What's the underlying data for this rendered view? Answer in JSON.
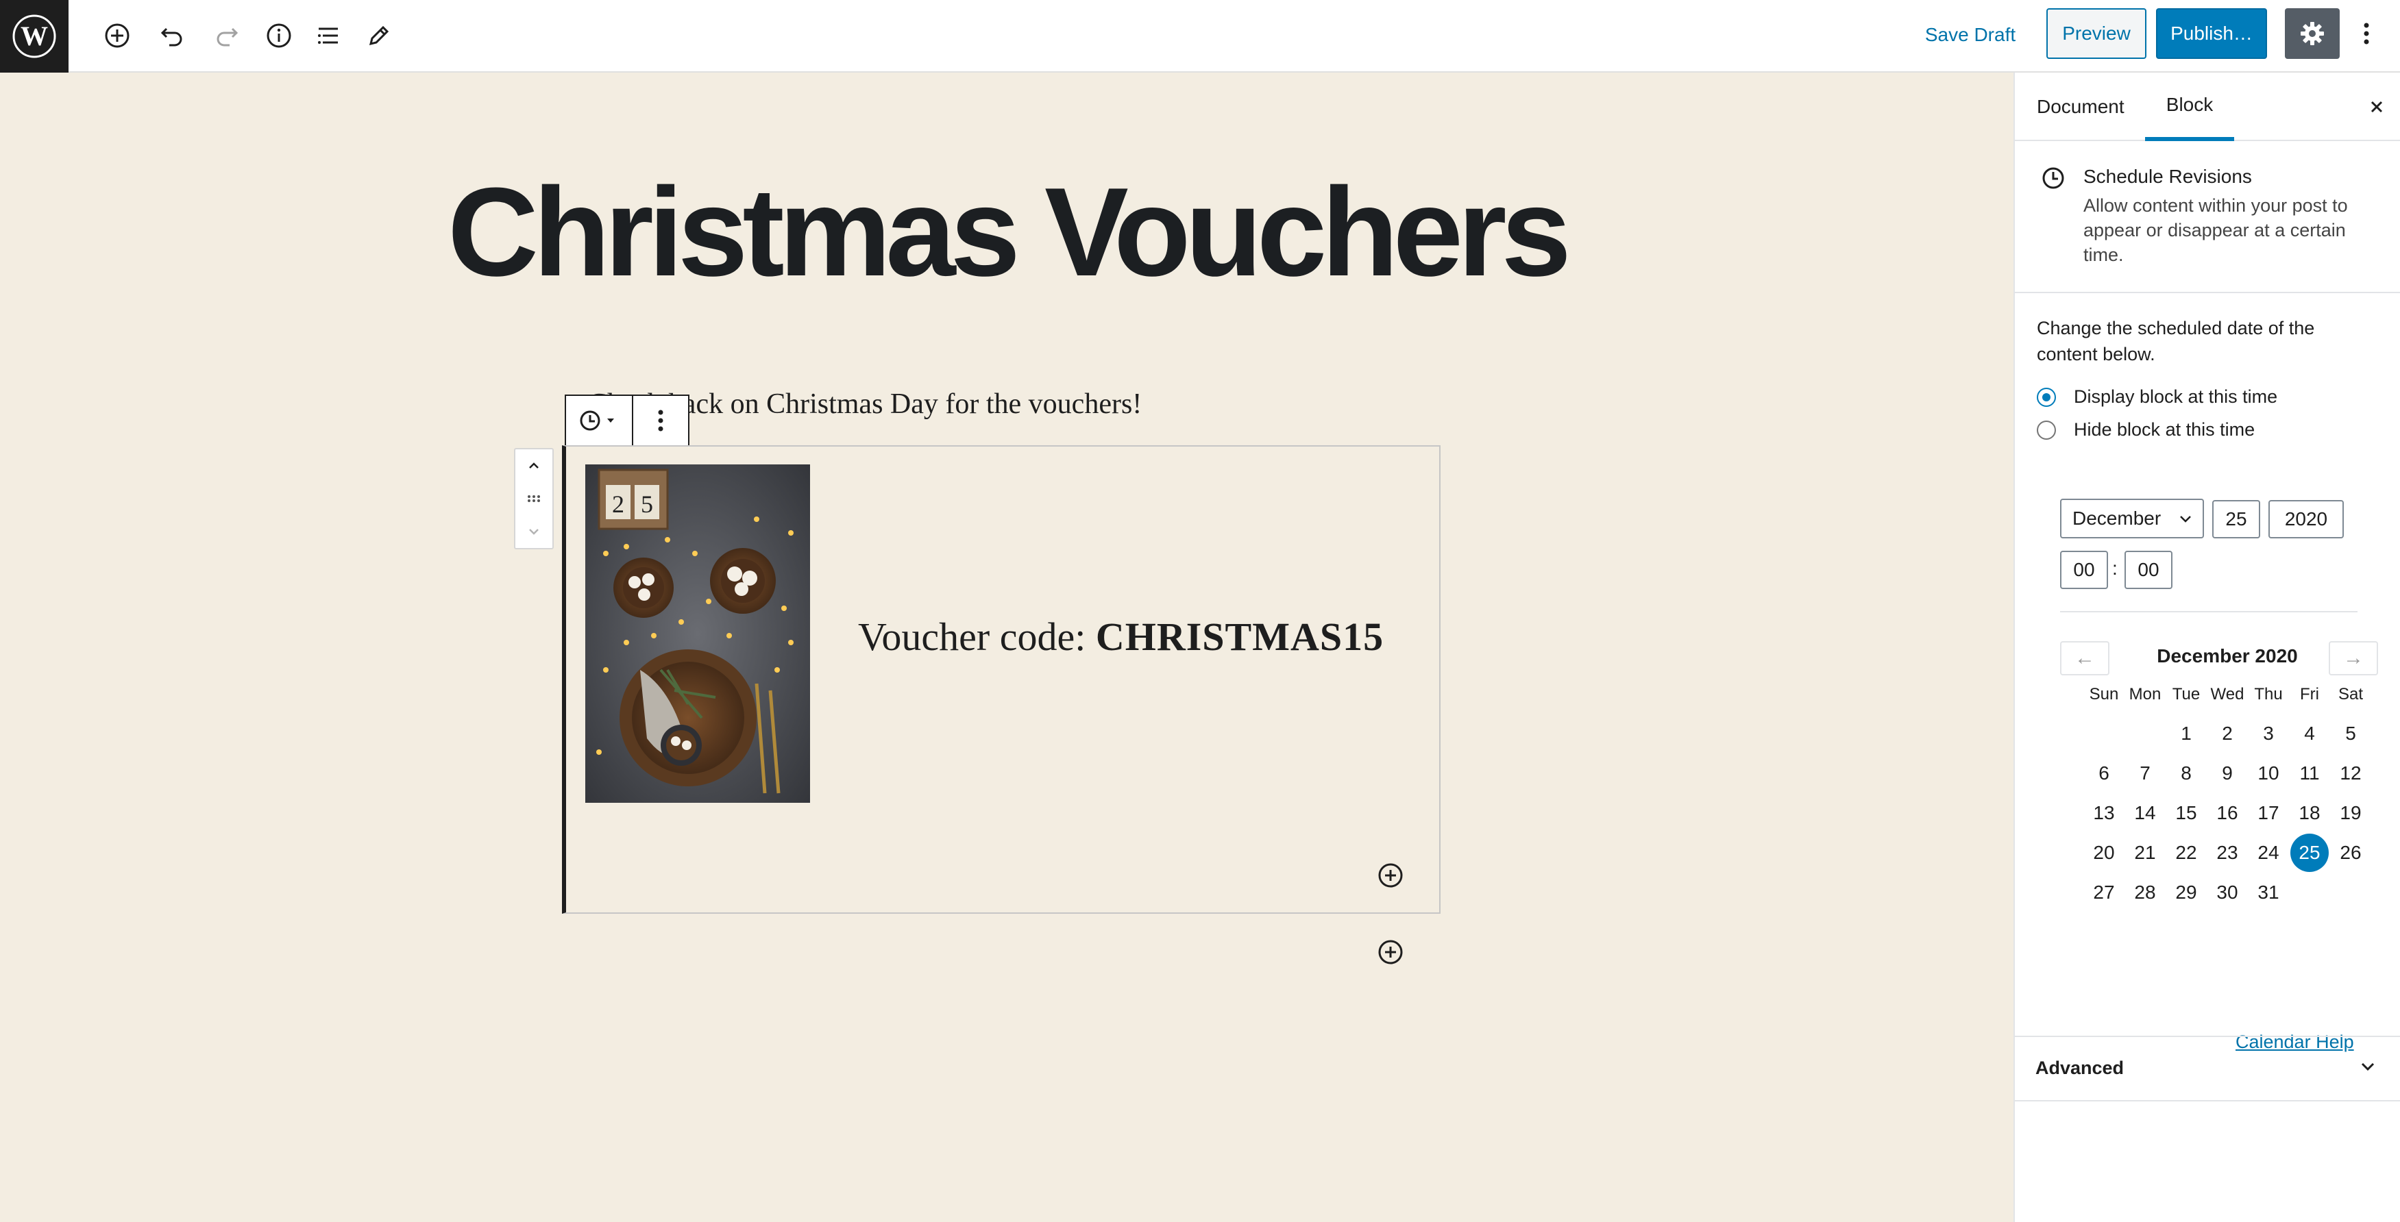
{
  "toolbar": {
    "save_draft": "Save Draft",
    "preview": "Preview",
    "publish": "Publish…",
    "icons": [
      "wordpress-logo",
      "add-block-icon",
      "undo-icon",
      "redo-icon",
      "info-icon",
      "outline-icon",
      "edit-mode-icon",
      "settings-gear-icon",
      "more-options-icon"
    ]
  },
  "editor": {
    "title": "Christmas Vouchers",
    "paragraph": "Check back on Christmas Day for the vouchers!",
    "voucher_prefix": "Voucher code:",
    "voucher_code": "CHRISTMAS15"
  },
  "sidebar": {
    "tabs": {
      "document": "Document",
      "block": "Block"
    },
    "schedule": {
      "title": "Schedule Revisions",
      "description": "Allow content within your post to appear or disappear at a certain time."
    },
    "change_text": "Change the scheduled date of the content below.",
    "radios": {
      "display": "Display block at this time",
      "hide": "Hide block at this time",
      "selected": "display"
    },
    "date": {
      "month": "December",
      "day": "25",
      "year": "2020",
      "hour": "00",
      "minute": "00",
      "separator": ":"
    },
    "calendar": {
      "title": "December 2020",
      "prev": "←",
      "next": "→",
      "weekdays": [
        "Sun",
        "Mon",
        "Tue",
        "Wed",
        "Thu",
        "Fri",
        "Sat"
      ],
      "weeks": [
        [
          "",
          "",
          "1",
          "2",
          "3",
          "4",
          "5"
        ],
        [
          "6",
          "7",
          "8",
          "9",
          "10",
          "11",
          "12"
        ],
        [
          "13",
          "14",
          "15",
          "16",
          "17",
          "18",
          "19"
        ],
        [
          "20",
          "21",
          "22",
          "23",
          "24",
          "25",
          "26"
        ],
        [
          "27",
          "28",
          "29",
          "30",
          "31",
          "",
          ""
        ]
      ],
      "selected_day": "25",
      "help": "Calendar Help"
    },
    "advanced": "Advanced"
  },
  "colors": {
    "accent": "#007cba",
    "canvas": "#f3ede1",
    "dark": "#1e1e1e"
  }
}
